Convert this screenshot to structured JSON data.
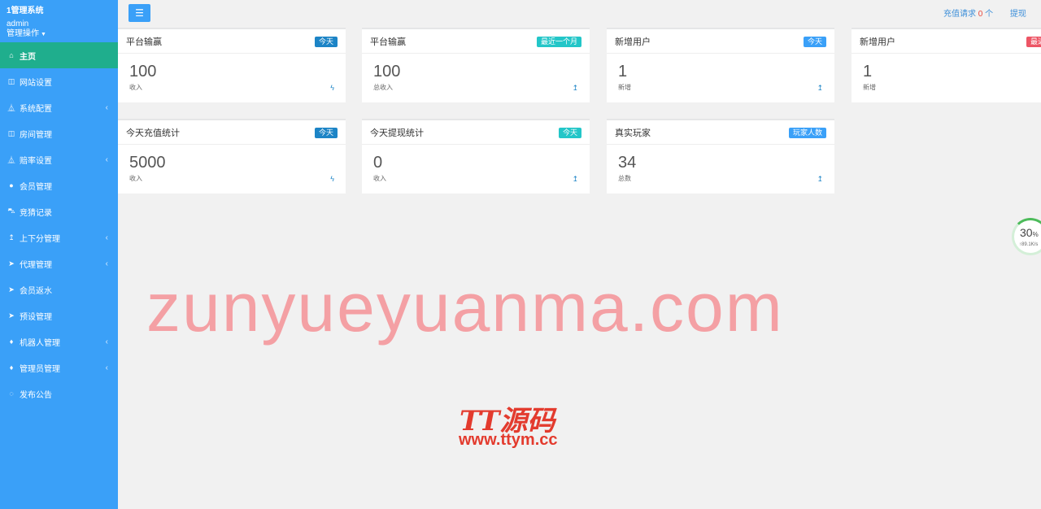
{
  "sidebar": {
    "brand_title": "1管理系统",
    "user": "admin",
    "user_menu": "管理操作",
    "items": [
      {
        "label": "主页",
        "icon": "home-icon",
        "glyph": "⌂",
        "chevron": false,
        "active": true
      },
      {
        "label": "网站设置",
        "icon": "columns-icon",
        "glyph": "◫",
        "chevron": false,
        "active": false
      },
      {
        "label": "系统配置",
        "icon": "flask-icon",
        "glyph": "⏅",
        "chevron": true,
        "active": false
      },
      {
        "label": "房间管理",
        "icon": "columns-icon",
        "glyph": "◫",
        "chevron": false,
        "active": false
      },
      {
        "label": "赔率设置",
        "icon": "flask-icon",
        "glyph": "⏅",
        "chevron": true,
        "active": false
      },
      {
        "label": "会员管理",
        "icon": "user-icon",
        "glyph": "●",
        "chevron": false,
        "active": false
      },
      {
        "label": "竞猜记录",
        "icon": "car-icon",
        "glyph": "⛍",
        "chevron": false,
        "active": false
      },
      {
        "label": "上下分管理",
        "icon": "level-up-icon",
        "glyph": "↥",
        "chevron": true,
        "active": false
      },
      {
        "label": "代理管理",
        "icon": "paper-plane-icon",
        "glyph": "➤",
        "chevron": true,
        "active": false
      },
      {
        "label": "会员返水",
        "icon": "paper-plane-icon",
        "glyph": "➤",
        "chevron": false,
        "active": false
      },
      {
        "label": "预设管理",
        "icon": "paper-plane-icon",
        "glyph": "➤",
        "chevron": false,
        "active": false
      },
      {
        "label": "机器人管理",
        "icon": "android-icon",
        "glyph": "♦",
        "chevron": true,
        "active": false
      },
      {
        "label": "管理员管理",
        "icon": "android-icon",
        "glyph": "♦",
        "chevron": true,
        "active": false
      },
      {
        "label": "发布公告",
        "icon": "comment-icon",
        "glyph": "◌",
        "chevron": false,
        "active": false
      }
    ]
  },
  "topbar": {
    "recharge_label": "充值请求",
    "recharge_count": "0",
    "recharge_unit": "个",
    "withdraw_label": "提现"
  },
  "cards": [
    {
      "title": "平台输赢",
      "badge": "今天",
      "badge_color": "#1c84c6",
      "value": "100",
      "label": "收入",
      "icon": "bolt-icon",
      "glyph": "ϟ"
    },
    {
      "title": "平台输赢",
      "badge": "最近一个月",
      "badge_color": "#23c6c8",
      "value": "100",
      "label": "总收入",
      "icon": "level-up-icon",
      "glyph": "↥"
    },
    {
      "title": "新增用户",
      "badge": "今天",
      "badge_color": "#3aa0f8",
      "value": "1",
      "label": "新增",
      "icon": "level-up-icon",
      "glyph": "↥"
    },
    {
      "title": "新增用户",
      "badge": "最近一个月",
      "badge_color": "#ed5565",
      "value": "1",
      "label": "新增",
      "icon": "level-up-icon",
      "glyph": "↥"
    },
    {
      "title": "今天充值统计",
      "badge": "今天",
      "badge_color": "#1c84c6",
      "value": "5000",
      "label": "收入",
      "icon": "bolt-icon",
      "glyph": "ϟ"
    },
    {
      "title": "今天提现统计",
      "badge": "今天",
      "badge_color": "#23c6c8",
      "value": "0",
      "label": "收入",
      "icon": "level-up-icon",
      "glyph": "↥"
    },
    {
      "title": "真实玩家",
      "badge": "玩家人数",
      "badge_color": "#3aa0f8",
      "value": "34",
      "label": "总数",
      "icon": "level-up-icon",
      "glyph": "↥"
    }
  ],
  "speed_widget": {
    "percent": "30",
    "unit": "%",
    "speed": "↑89.1K/s"
  },
  "watermark": {
    "text": "zunyueyuanma.com",
    "logo": "TT源码",
    "url": "www.ttym.cc"
  }
}
